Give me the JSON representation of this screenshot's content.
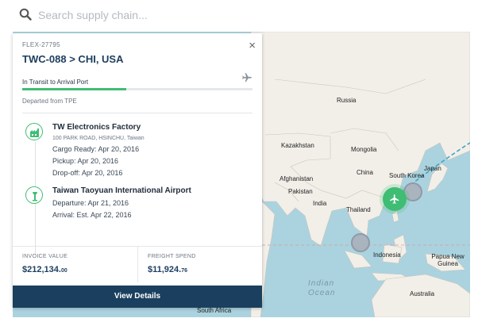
{
  "search": {
    "placeholder": "Search supply chain...",
    "icon": "search-icon"
  },
  "card": {
    "shipment_id": "FLEX-27795",
    "route": "TWC-088 > CHI, USA",
    "status": "In Transit to Arrival Port",
    "progress": 0.45,
    "departed": "Departed from TPE",
    "close_label": "×",
    "stops": [
      {
        "name": "TW Electronics Factory",
        "address": "100 PARK ROAD, HSINCHU, Taiwan",
        "lines": [
          "Cargo Ready: Apr 20, 2016",
          "Pickup: Apr 20, 2016",
          "Drop-off: Apr 20, 2016"
        ],
        "icon": "factory-icon"
      },
      {
        "name": "Taiwan Taoyuan International Airport",
        "lines": [
          "Departure: Apr 21, 2016",
          "Arrival: Est. Apr 22, 2016"
        ],
        "icon": "airport-tower-icon"
      }
    ],
    "invoice": {
      "label": "INVOICE VALUE",
      "value": "$212,134.",
      "cents": "00"
    },
    "freight": {
      "label": "FREIGHT SPEND",
      "value": "$11,924.",
      "cents": "76"
    },
    "button_label": "View Details"
  },
  "map": {
    "labels": {
      "russia": "Russia",
      "kazakhstan": "Kazakhstan",
      "mongolia": "Mongolia",
      "china": "China",
      "afghanistan": "Afghanistan",
      "pakistan": "Pakistan",
      "south_korea": "South Korea",
      "japan": "Japan",
      "india": "India",
      "thailand": "Thailand",
      "indonesia": "Indonesia",
      "papua": "Papua New Guinea",
      "australia": "Australia",
      "south_africa": "South Africa",
      "indian_ocean_1": "Indian",
      "indian_ocean_2": "Ocean"
    },
    "colors": {
      "water": "#aad3df",
      "land": "#f2efe9",
      "route": "#3fa4c4",
      "accent": "#3fbd74"
    }
  }
}
